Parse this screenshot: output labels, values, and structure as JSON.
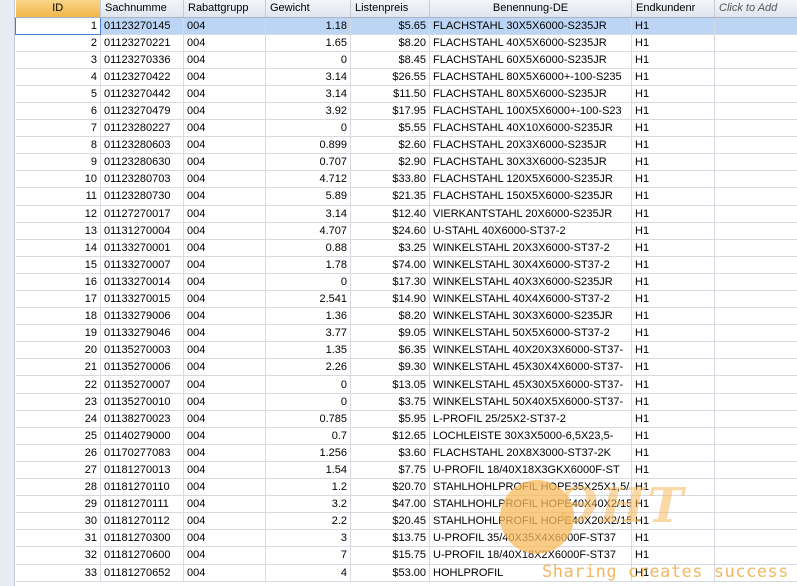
{
  "columns": [
    {
      "label": "ID",
      "align": "right"
    },
    {
      "label": "Sachnumme",
      "align": "left"
    },
    {
      "label": "Rabattgrupp",
      "align": "left"
    },
    {
      "label": "Gewicht",
      "align": "right"
    },
    {
      "label": "Listenpreis",
      "align": "right"
    },
    {
      "label": "Benennung-DE",
      "align": "left"
    },
    {
      "label": "Endkundenr",
      "align": "left"
    },
    {
      "label": "Click to Add",
      "align": "left"
    }
  ],
  "selected_row": 1,
  "rows": [
    [
      "1",
      "01123270145",
      "004",
      "1.18",
      "$5.65",
      "FLACHSTAHL 30X5X6000-S235JR",
      "H1"
    ],
    [
      "2",
      "01123270221",
      "004",
      "1.65",
      "$8.20",
      "FLACHSTAHL 40X5X6000-S235JR",
      "H1"
    ],
    [
      "3",
      "01123270336",
      "004",
      "0",
      "$8.45",
      "FLACHSTAHL 60X5X6000-S235JR",
      "H1"
    ],
    [
      "4",
      "01123270422",
      "004",
      "3.14",
      "$26.55",
      "FLACHSTAHL 80X5X6000+-100-S235",
      "H1"
    ],
    [
      "5",
      "01123270442",
      "004",
      "3.14",
      "$11.50",
      "FLACHSTAHL 80X5X6000-S235JR",
      "H1"
    ],
    [
      "6",
      "01123270479",
      "004",
      "3.92",
      "$17.95",
      "FLACHSTAHL 100X5X6000+-100-S23",
      "H1"
    ],
    [
      "7",
      "01123280227",
      "004",
      "0",
      "$5.55",
      "FLACHSTAHL 40X10X6000-S235JR",
      "H1"
    ],
    [
      "8",
      "01123280603",
      "004",
      "0.899",
      "$2.60",
      "FLACHSTAHL 20X3X6000-S235JR",
      "H1"
    ],
    [
      "9",
      "01123280630",
      "004",
      "0.707",
      "$2.90",
      "FLACHSTAHL 30X3X6000-S235JR",
      "H1"
    ],
    [
      "10",
      "01123280703",
      "004",
      "4.712",
      "$33.80",
      "FLACHSTAHL 120X5X6000-S235JR",
      "H1"
    ],
    [
      "11",
      "01123280730",
      "004",
      "5.89",
      "$21.35",
      "FLACHSTAHL 150X5X6000-S235JR",
      "H1"
    ],
    [
      "12",
      "01127270017",
      "004",
      "3.14",
      "$12.40",
      "VIERKANTSTAHL 20X6000-S235JR",
      "H1"
    ],
    [
      "13",
      "01131270004",
      "004",
      "4.707",
      "$24.60",
      "U-STAHL 40X6000-ST37-2",
      "H1"
    ],
    [
      "14",
      "01133270001",
      "004",
      "0.88",
      "$3.25",
      "WINKELSTAHL 20X3X6000-ST37-2",
      "H1"
    ],
    [
      "15",
      "01133270007",
      "004",
      "1.78",
      "$74.00",
      "WINKELSTAHL 30X4X6000-ST37-2",
      "H1"
    ],
    [
      "16",
      "01133270014",
      "004",
      "0",
      "$17.30",
      "WINKELSTAHL 40X3X6000-S235JR",
      "H1"
    ],
    [
      "17",
      "01133270015",
      "004",
      "2.541",
      "$14.90",
      "WINKELSTAHL 40X4X6000-ST37-2",
      "H1"
    ],
    [
      "18",
      "01133279006",
      "004",
      "1.36",
      "$8.20",
      "WINKELSTAHL 30X3X6000-S235JR",
      "H1"
    ],
    [
      "19",
      "01133279046",
      "004",
      "3.77",
      "$9.05",
      "WINKELSTAHL 50X5X6000-ST37-2",
      "H1"
    ],
    [
      "20",
      "01135270003",
      "004",
      "1.35",
      "$6.35",
      "WINKELSTAHL 40X20X3X6000-ST37-",
      "H1"
    ],
    [
      "21",
      "01135270006",
      "004",
      "2.26",
      "$9.30",
      "WINKELSTAHL 45X30X4X6000-ST37-",
      "H1"
    ],
    [
      "22",
      "01135270007",
      "004",
      "0",
      "$13.05",
      "WINKELSTAHL 45X30X5X6000-ST37-",
      "H1"
    ],
    [
      "23",
      "01135270010",
      "004",
      "0",
      "$3.75",
      "WINKELSTAHL 50X40X5X6000-ST37-",
      "H1"
    ],
    [
      "24",
      "01138270023",
      "004",
      "0.785",
      "$5.95",
      "L-PROFIL 25/25X2-ST37-2",
      "H1"
    ],
    [
      "25",
      "01140279000",
      "004",
      "0.7",
      "$12.65",
      "LOCHLEISTE 30X3X5000-6,5X23,5-",
      "H1"
    ],
    [
      "26",
      "01170277083",
      "004",
      "1.256",
      "$3.60",
      "FLACHSTAHL 20X8X3000-ST37-2K",
      "H1"
    ],
    [
      "27",
      "01181270013",
      "004",
      "1.54",
      "$7.75",
      "U-PROFIL 18/40X18X3GKX6000F-ST",
      "H1"
    ],
    [
      "28",
      "01181270110",
      "004",
      "1.2",
      "$20.70",
      "STAHLHOHLPROFIL HOPE35X25X1,5/",
      "H1"
    ],
    [
      "29",
      "01181270111",
      "004",
      "3.2",
      "$47.00",
      "STAHLHOHLPROFIL HOPE40X40X2/15",
      "H1"
    ],
    [
      "30",
      "01181270112",
      "004",
      "2.2",
      "$20.45",
      "STAHLHOHLPROFIL HOPE40X20X2/15",
      "H1"
    ],
    [
      "31",
      "01181270300",
      "004",
      "3",
      "$13.75",
      "U-PROFIL 35/40X35X4X6000F-ST37",
      "H1"
    ],
    [
      "32",
      "01181270600",
      "004",
      "7",
      "$15.75",
      "U-PROFIL 18/40X18X2X6000F-ST37",
      "H1"
    ],
    [
      "33",
      "01181270652",
      "004",
      "4",
      "$53.00",
      "HOHLPROFIL",
      "H1"
    ]
  ],
  "watermark": {
    "tagline": "Sharing creates success",
    "logo": "ЭНТ"
  },
  "colors": {
    "header_sorted": "#f2b64a",
    "selected_row": "#bdd5f5",
    "watermark": "#f7ba5c"
  }
}
